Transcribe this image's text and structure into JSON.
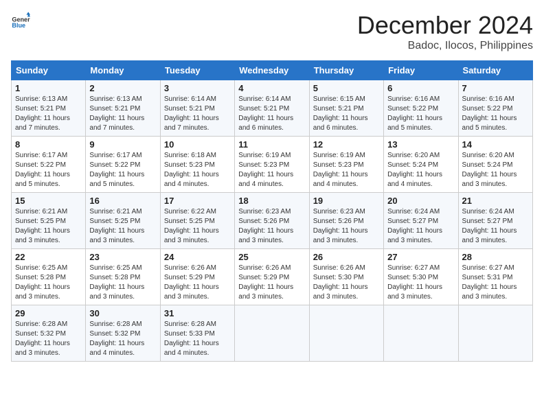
{
  "logo": {
    "general": "General",
    "blue": "Blue"
  },
  "title": {
    "month": "December 2024",
    "location": "Badoc, Ilocos, Philippines"
  },
  "headers": [
    "Sunday",
    "Monday",
    "Tuesday",
    "Wednesday",
    "Thursday",
    "Friday",
    "Saturday"
  ],
  "weeks": [
    [
      {
        "day": "1",
        "lines": [
          "Sunrise: 6:13 AM",
          "Sunset: 5:21 PM",
          "Daylight: 11 hours",
          "and 7 minutes."
        ]
      },
      {
        "day": "2",
        "lines": [
          "Sunrise: 6:13 AM",
          "Sunset: 5:21 PM",
          "Daylight: 11 hours",
          "and 7 minutes."
        ]
      },
      {
        "day": "3",
        "lines": [
          "Sunrise: 6:14 AM",
          "Sunset: 5:21 PM",
          "Daylight: 11 hours",
          "and 7 minutes."
        ]
      },
      {
        "day": "4",
        "lines": [
          "Sunrise: 6:14 AM",
          "Sunset: 5:21 PM",
          "Daylight: 11 hours",
          "and 6 minutes."
        ]
      },
      {
        "day": "5",
        "lines": [
          "Sunrise: 6:15 AM",
          "Sunset: 5:21 PM",
          "Daylight: 11 hours",
          "and 6 minutes."
        ]
      },
      {
        "day": "6",
        "lines": [
          "Sunrise: 6:16 AM",
          "Sunset: 5:22 PM",
          "Daylight: 11 hours",
          "and 5 minutes."
        ]
      },
      {
        "day": "7",
        "lines": [
          "Sunrise: 6:16 AM",
          "Sunset: 5:22 PM",
          "Daylight: 11 hours",
          "and 5 minutes."
        ]
      }
    ],
    [
      {
        "day": "8",
        "lines": [
          "Sunrise: 6:17 AM",
          "Sunset: 5:22 PM",
          "Daylight: 11 hours",
          "and 5 minutes."
        ]
      },
      {
        "day": "9",
        "lines": [
          "Sunrise: 6:17 AM",
          "Sunset: 5:22 PM",
          "Daylight: 11 hours",
          "and 5 minutes."
        ]
      },
      {
        "day": "10",
        "lines": [
          "Sunrise: 6:18 AM",
          "Sunset: 5:23 PM",
          "Daylight: 11 hours",
          "and 4 minutes."
        ]
      },
      {
        "day": "11",
        "lines": [
          "Sunrise: 6:19 AM",
          "Sunset: 5:23 PM",
          "Daylight: 11 hours",
          "and 4 minutes."
        ]
      },
      {
        "day": "12",
        "lines": [
          "Sunrise: 6:19 AM",
          "Sunset: 5:23 PM",
          "Daylight: 11 hours",
          "and 4 minutes."
        ]
      },
      {
        "day": "13",
        "lines": [
          "Sunrise: 6:20 AM",
          "Sunset: 5:24 PM",
          "Daylight: 11 hours",
          "and 4 minutes."
        ]
      },
      {
        "day": "14",
        "lines": [
          "Sunrise: 6:20 AM",
          "Sunset: 5:24 PM",
          "Daylight: 11 hours",
          "and 3 minutes."
        ]
      }
    ],
    [
      {
        "day": "15",
        "lines": [
          "Sunrise: 6:21 AM",
          "Sunset: 5:25 PM",
          "Daylight: 11 hours",
          "and 3 minutes."
        ]
      },
      {
        "day": "16",
        "lines": [
          "Sunrise: 6:21 AM",
          "Sunset: 5:25 PM",
          "Daylight: 11 hours",
          "and 3 minutes."
        ]
      },
      {
        "day": "17",
        "lines": [
          "Sunrise: 6:22 AM",
          "Sunset: 5:25 PM",
          "Daylight: 11 hours",
          "and 3 minutes."
        ]
      },
      {
        "day": "18",
        "lines": [
          "Sunrise: 6:23 AM",
          "Sunset: 5:26 PM",
          "Daylight: 11 hours",
          "and 3 minutes."
        ]
      },
      {
        "day": "19",
        "lines": [
          "Sunrise: 6:23 AM",
          "Sunset: 5:26 PM",
          "Daylight: 11 hours",
          "and 3 minutes."
        ]
      },
      {
        "day": "20",
        "lines": [
          "Sunrise: 6:24 AM",
          "Sunset: 5:27 PM",
          "Daylight: 11 hours",
          "and 3 minutes."
        ]
      },
      {
        "day": "21",
        "lines": [
          "Sunrise: 6:24 AM",
          "Sunset: 5:27 PM",
          "Daylight: 11 hours",
          "and 3 minutes."
        ]
      }
    ],
    [
      {
        "day": "22",
        "lines": [
          "Sunrise: 6:25 AM",
          "Sunset: 5:28 PM",
          "Daylight: 11 hours",
          "and 3 minutes."
        ]
      },
      {
        "day": "23",
        "lines": [
          "Sunrise: 6:25 AM",
          "Sunset: 5:28 PM",
          "Daylight: 11 hours",
          "and 3 minutes."
        ]
      },
      {
        "day": "24",
        "lines": [
          "Sunrise: 6:26 AM",
          "Sunset: 5:29 PM",
          "Daylight: 11 hours",
          "and 3 minutes."
        ]
      },
      {
        "day": "25",
        "lines": [
          "Sunrise: 6:26 AM",
          "Sunset: 5:29 PM",
          "Daylight: 11 hours",
          "and 3 minutes."
        ]
      },
      {
        "day": "26",
        "lines": [
          "Sunrise: 6:26 AM",
          "Sunset: 5:30 PM",
          "Daylight: 11 hours",
          "and 3 minutes."
        ]
      },
      {
        "day": "27",
        "lines": [
          "Sunrise: 6:27 AM",
          "Sunset: 5:30 PM",
          "Daylight: 11 hours",
          "and 3 minutes."
        ]
      },
      {
        "day": "28",
        "lines": [
          "Sunrise: 6:27 AM",
          "Sunset: 5:31 PM",
          "Daylight: 11 hours",
          "and 3 minutes."
        ]
      }
    ],
    [
      {
        "day": "29",
        "lines": [
          "Sunrise: 6:28 AM",
          "Sunset: 5:32 PM",
          "Daylight: 11 hours",
          "and 3 minutes."
        ]
      },
      {
        "day": "30",
        "lines": [
          "Sunrise: 6:28 AM",
          "Sunset: 5:32 PM",
          "Daylight: 11 hours",
          "and 4 minutes."
        ]
      },
      {
        "day": "31",
        "lines": [
          "Sunrise: 6:28 AM",
          "Sunset: 5:33 PM",
          "Daylight: 11 hours",
          "and 4 minutes."
        ]
      },
      {
        "day": "",
        "lines": []
      },
      {
        "day": "",
        "lines": []
      },
      {
        "day": "",
        "lines": []
      },
      {
        "day": "",
        "lines": []
      }
    ]
  ]
}
